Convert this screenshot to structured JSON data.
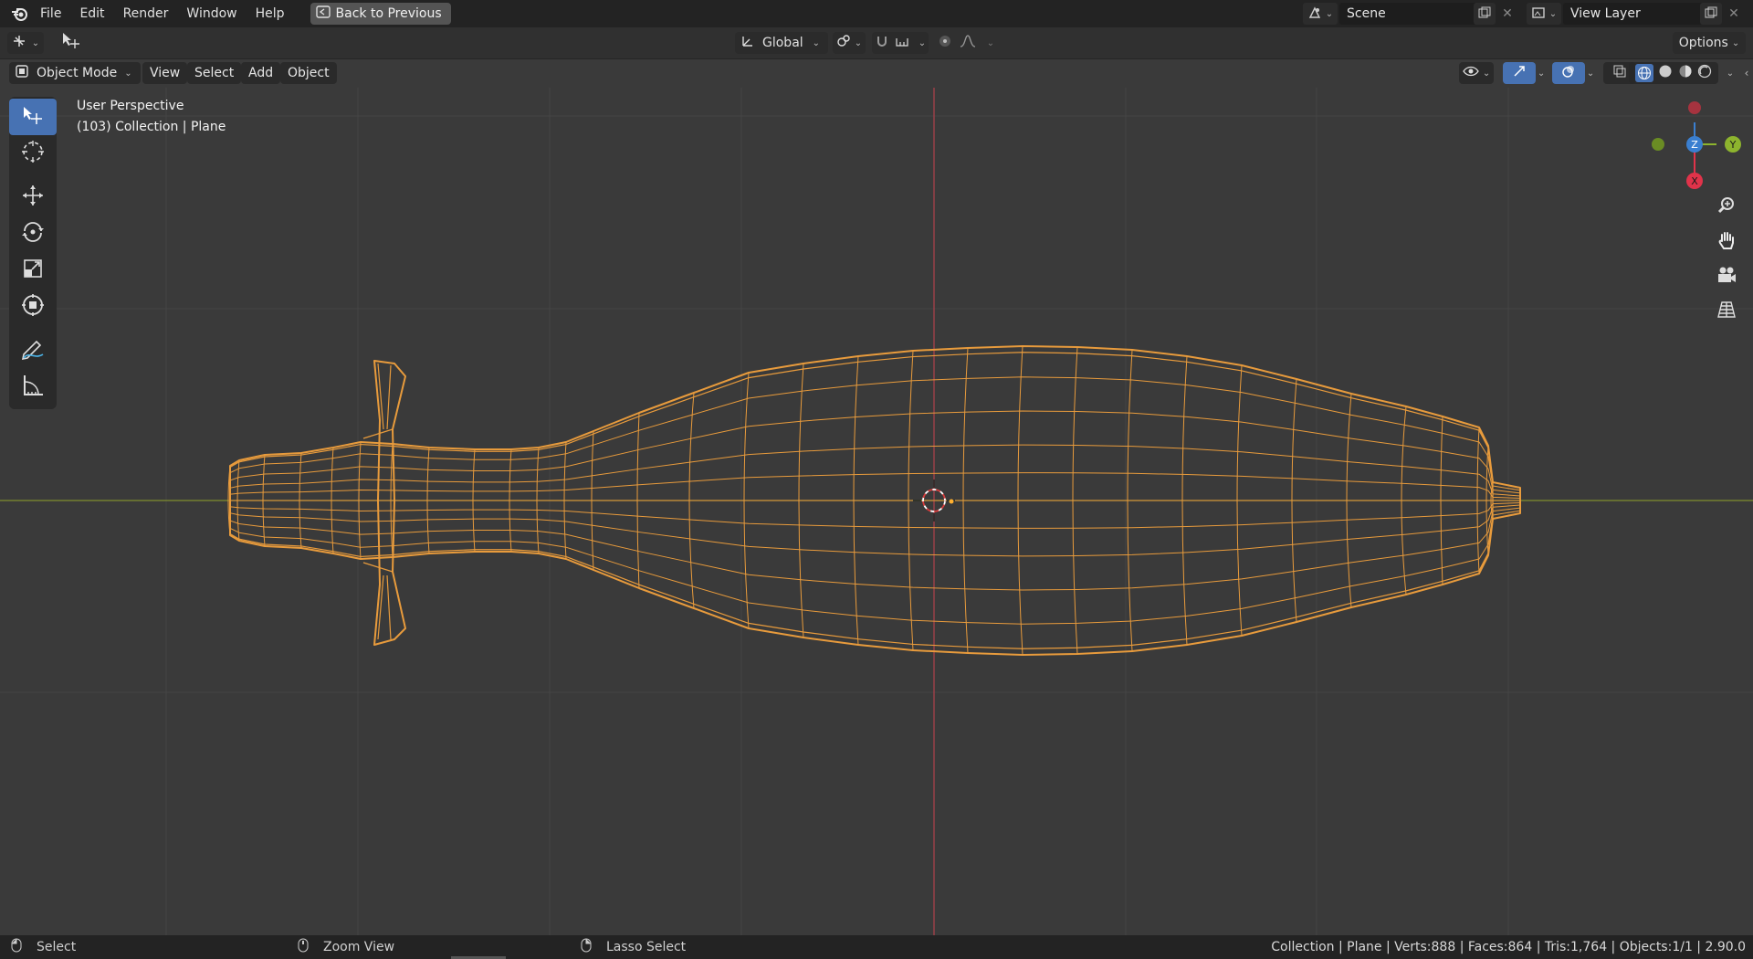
{
  "menubar": {
    "items": [
      "File",
      "Edit",
      "Render",
      "Window",
      "Help"
    ],
    "back_button": "Back to Previous",
    "scene": "Scene",
    "view_layer": "View Layer"
  },
  "tool_header": {
    "orientation": "Global",
    "options": "Options"
  },
  "viewport_header": {
    "mode": "Object Mode",
    "menus": [
      "View",
      "Select",
      "Add",
      "Object"
    ]
  },
  "viewport": {
    "perspective": "User Perspective",
    "collection_info": "(103) Collection | Plane"
  },
  "gizmo": {
    "z_label": "Z",
    "y_label": "Y",
    "x_label": "X"
  },
  "statusbar": {
    "select": "Select",
    "zoom_view": "Zoom View",
    "lasso_select": "Lasso Select",
    "stats": "Collection | Plane | Verts:888 | Faces:864 | Tris:1,764 | Objects:1/1 | 2.90.0"
  },
  "colors": {
    "wire": "#e89b3c",
    "x_axis": "#a6424a",
    "y_axis": "#8da030",
    "active_tool": "#4772b3"
  }
}
